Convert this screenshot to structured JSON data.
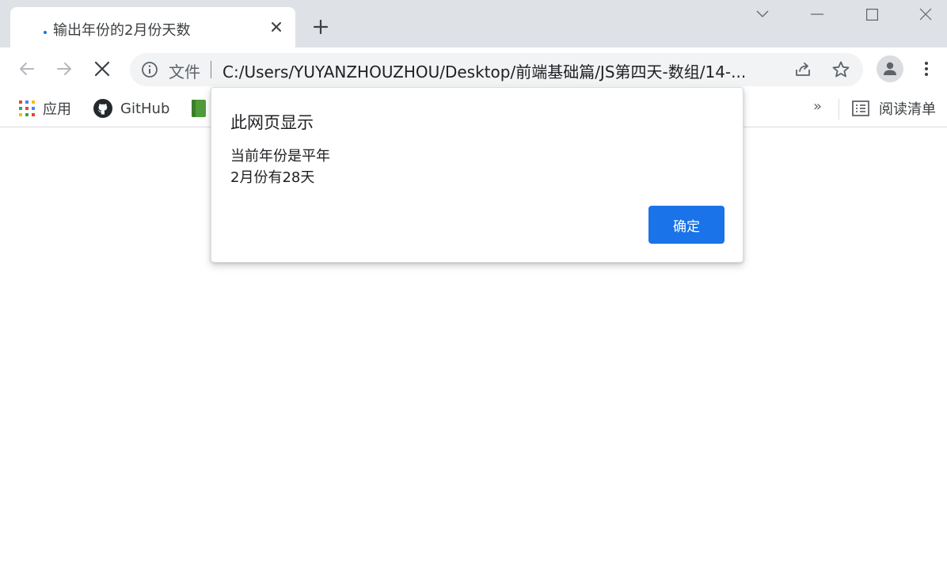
{
  "tab": {
    "title": "输出年份的2月份天数",
    "close_icon": "close-icon",
    "new_tab_icon": "plus-icon"
  },
  "window_controls": [
    "chevron-down-icon",
    "minimize-icon",
    "maximize-icon",
    "close-icon"
  ],
  "toolbar": {
    "back_icon": "arrow-left-icon",
    "forward_icon": "arrow-right-icon",
    "stop_icon": "close-icon",
    "omnibox": {
      "security_label": "文件",
      "url": "C:/Users/YUYANZHOUZHOU/Desktop/前端基础篇/JS第四天-数组/14-..."
    }
  },
  "bookmarks": {
    "items": [
      {
        "label": "应用",
        "icon": "apps-grid-icon"
      },
      {
        "label": "GitHub",
        "icon": "github-icon"
      },
      {
        "label": "",
        "icon": "book-icon"
      }
    ],
    "more": "»",
    "reading_list": "阅读清单"
  },
  "dialog": {
    "title": "此网页显示",
    "message_lines": [
      "当前年份是平年",
      "2月份有28天"
    ],
    "ok_label": "确定"
  },
  "colors": {
    "accent": "#1a73e8",
    "tabstrip": "#dee1e6",
    "omnibox": "#f1f3f4"
  }
}
